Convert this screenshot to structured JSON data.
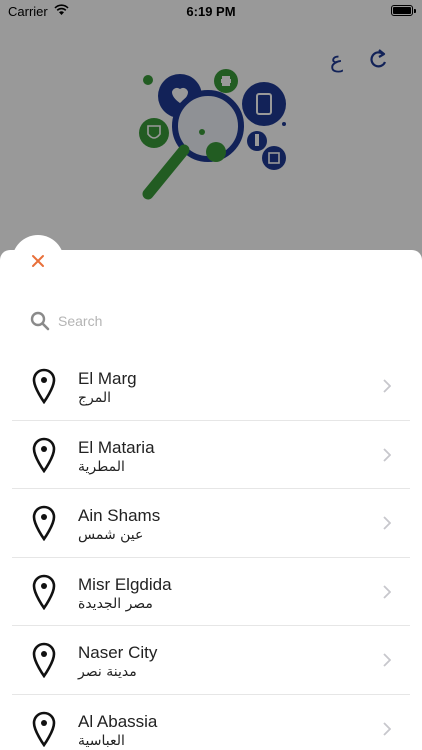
{
  "status_bar": {
    "carrier": "Carrier",
    "time": "6:19 PM"
  },
  "header": {
    "language_label": "ع"
  },
  "search": {
    "placeholder": "Search"
  },
  "areas": [
    {
      "en": "El Marg",
      "ar": "المرج"
    },
    {
      "en": "El Mataria",
      "ar": "المطرية"
    },
    {
      "en": "Ain Shams",
      "ar": "عين شمس"
    },
    {
      "en": "Misr Elgdida",
      "ar": "مصر الجديدة"
    },
    {
      "en": "Naser City",
      "ar": "مدينة نصر"
    },
    {
      "en": "Al Abassia",
      "ar": "العباسية"
    }
  ],
  "colors": {
    "accent": "#e8703a",
    "brand_blue": "#1f3a93",
    "brand_green": "#3a9a3a"
  },
  "icons": {
    "close": "close-icon",
    "search": "search-icon",
    "pin": "location-pin-icon",
    "chevron": "chevron-right-icon"
  }
}
